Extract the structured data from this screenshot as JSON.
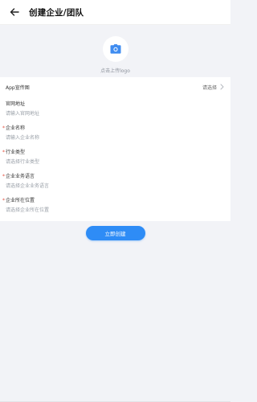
{
  "header": {
    "title": "创建企业/团队"
  },
  "logo": {
    "label": "点击上传logo"
  },
  "form": {
    "app_banner": {
      "label": "App宣传图",
      "value": "请选择"
    },
    "website": {
      "label": "官网地址",
      "required": false,
      "placeholder": "请输入官网地址"
    },
    "company_name": {
      "label": "企业名称",
      "required": true,
      "placeholder": "请输入企业名称"
    },
    "industry": {
      "label": "行业类型",
      "required": true,
      "placeholder": "请选择行业类型"
    },
    "business_language": {
      "label": "企业业务语言",
      "required": true,
      "placeholder": "请选择企业业务语言"
    },
    "location": {
      "label": "企业所在位置",
      "required": true,
      "placeholder": "请选择企业所在位置"
    }
  },
  "actions": {
    "submit_label": "立即创建"
  },
  "colors": {
    "accent": "#2e8cf6",
    "required": "#e14d3c",
    "background": "#f2f3f7"
  },
  "icons": {
    "back": "arrow-left-icon",
    "camera": "camera-icon",
    "chevron": "chevron-right-icon"
  }
}
